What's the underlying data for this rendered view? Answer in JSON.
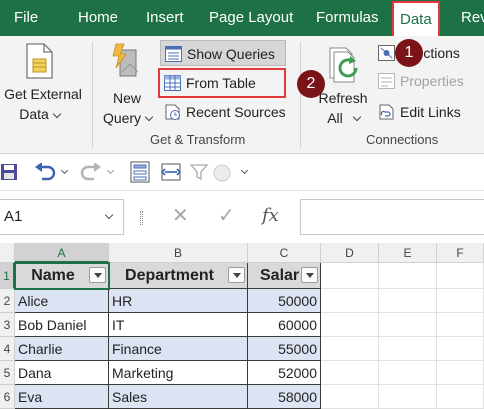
{
  "menu": {
    "tabs": [
      {
        "label": "File"
      },
      {
        "label": "Home"
      },
      {
        "label": "Insert"
      },
      {
        "label": "Page Layout"
      },
      {
        "label": "Formulas"
      },
      {
        "label": "Data"
      },
      {
        "label": "Rev"
      }
    ],
    "active_tab": "Data"
  },
  "ribbon": {
    "get_external": {
      "line1": "Get External",
      "line2": "Data"
    },
    "new_query": {
      "line1": "New",
      "line2": "Query"
    },
    "show_queries": "Show Queries",
    "from_table": "From Table",
    "recent_sources": "Recent Sources",
    "group_get_transform": "Get & Transform",
    "refresh": {
      "line1": "Refresh",
      "line2": "All"
    },
    "connections": "nnections",
    "properties": "Properties",
    "edit_links": "Edit Links",
    "group_connections": "Connections",
    "badge1": "1",
    "badge2": "2"
  },
  "formula_bar": {
    "name_box": "A1",
    "fx": "fx"
  },
  "grid": {
    "columns": [
      "A",
      "B",
      "C",
      "D",
      "E",
      "F"
    ],
    "rows": [
      "1",
      "2",
      "3",
      "4",
      "5",
      "6"
    ],
    "headers": [
      "Name",
      "Department",
      "Salar"
    ],
    "data": [
      [
        "Alice",
        "HR",
        "50000"
      ],
      [
        "Bob Daniel",
        "IT",
        "60000"
      ],
      [
        "Charlie",
        "Finance",
        "55000"
      ],
      [
        "Dana",
        "Marketing",
        "52000"
      ],
      [
        "Eva",
        "Sales",
        "58000"
      ]
    ]
  },
  "colors": {
    "excel_green": "#1e7145",
    "highlight_red": "#e03a3a",
    "badge": "#7a1418",
    "row_band": "#dce3f3"
  }
}
